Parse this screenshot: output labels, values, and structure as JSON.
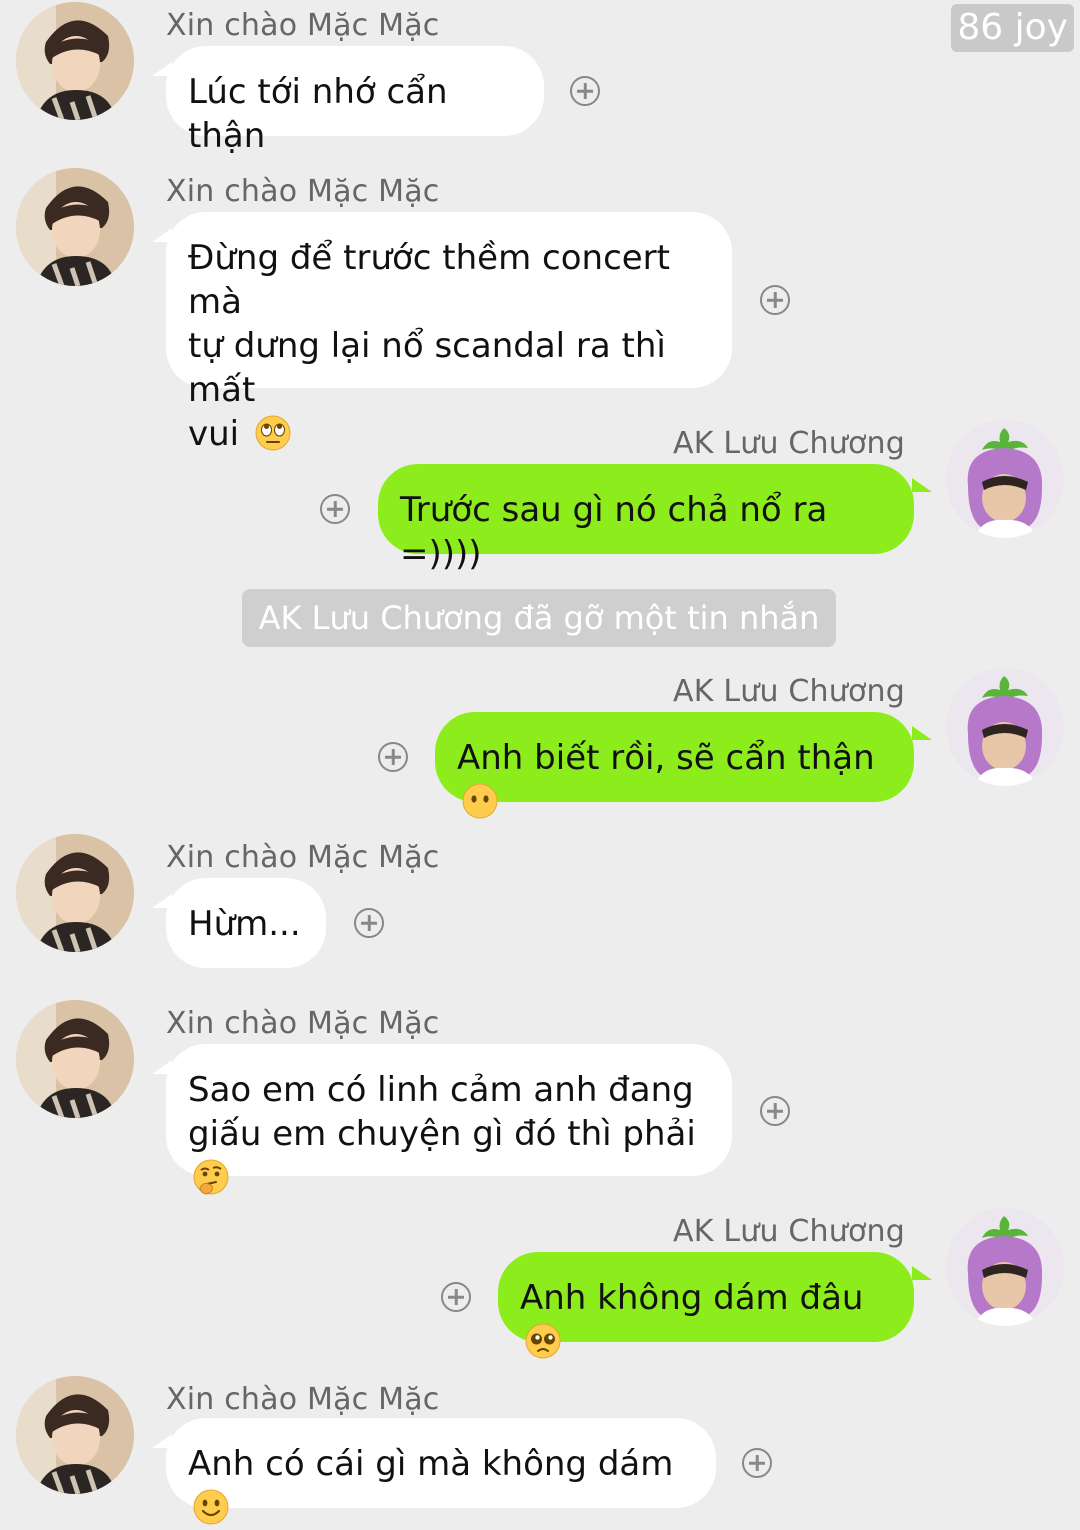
{
  "watermark": "86 joy",
  "contacts": {
    "other": "Xin chào Mặc Mặc",
    "me": "AK Lưu Chương"
  },
  "messages": [
    {
      "sender": "Xin chào Mặc Mặc",
      "text": "Lúc tới nhớ cẩn thận",
      "emoji": ""
    },
    {
      "sender": "Xin chào Mặc Mặc",
      "line1": "Đừng để trước thềm concert mà",
      "line2": "tự dưng lại nổ scandal ra thì mất",
      "line3": "vui",
      "emoji": "eye-roll-emoji"
    },
    {
      "sender": "AK Lưu Chương",
      "text": "Trước sau gì nó chả nổ ra =))))",
      "emoji": ""
    },
    {
      "sender": "AK Lưu Chương",
      "text": "Anh biết rồi, sẽ cẩn thận",
      "emoji": "no-mouth-emoji"
    },
    {
      "sender": "Xin chào Mặc Mặc",
      "text": "Hừm...",
      "emoji": ""
    },
    {
      "sender": "Xin chào Mặc Mặc",
      "line1": "Sao em có linh cảm anh đang",
      "line2": "giấu em chuyện gì đó thì phải",
      "emoji": "thinking-emoji"
    },
    {
      "sender": "AK Lưu Chương",
      "text": "Anh không dám đâu",
      "emoji": "pleading-emoji"
    },
    {
      "sender": "Xin chào Mặc Mặc",
      "text": "Anh có cái gì mà không dám",
      "emoji": "smile-emoji"
    }
  ],
  "system_notice": "AK Lưu Chương đã gỡ một tin nhắn",
  "colors": {
    "background": "#ededed",
    "incoming_bubble": "#ffffff",
    "outgoing_bubble": "#8ded1c",
    "name_text": "#666666",
    "system_notice_bg": "#cfcfcf"
  }
}
